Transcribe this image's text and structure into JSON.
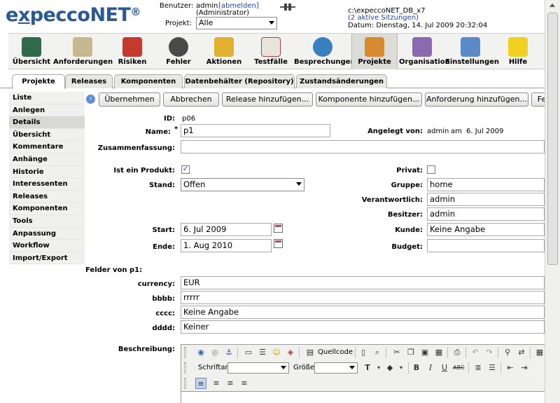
{
  "header": {
    "logo": {
      "part1": "e",
      "part2": "x",
      "part3": "pecco",
      "part4": "NET",
      "mark": "®"
    },
    "benutzer_label": "Benutzer:",
    "benutzer_name": "admin",
    "abmelden": "[abmelden]",
    "role": "(Administrator)",
    "projekt_label": "Projekt:",
    "projekt_value": "Alle",
    "db_path": "c:\\expeccoNET_DB_x7",
    "sessions": "(2 aktive Sitzungen)",
    "datum": "Datum: Dienstag, 14. Jul 2009 20:32:04"
  },
  "toolbar": [
    {
      "label": "Übersicht",
      "icon": "chart-icon"
    },
    {
      "label": "Anforderungen",
      "icon": "requirements-icon"
    },
    {
      "label": "Risiken",
      "icon": "risk-icon"
    },
    {
      "label": "Fehler",
      "icon": "bug-icon"
    },
    {
      "label": "Aktionen",
      "icon": "actions-icon"
    },
    {
      "label": "Testfälle",
      "icon": "testcases-icon"
    },
    {
      "label": "Besprechungen",
      "icon": "meetings-icon"
    },
    {
      "label": "Projekte",
      "icon": "projects-icon"
    },
    {
      "label": "Organisation",
      "icon": "organisation-icon"
    },
    {
      "label": "Einstellungen",
      "icon": "settings-icon"
    },
    {
      "label": "Hilfe",
      "icon": "help-icon"
    }
  ],
  "tabs": [
    "Projekte",
    "Releases",
    "Komponenten",
    "Datenbehälter (Repository)",
    "Zustandsänderungen"
  ],
  "sidebar": [
    "Liste",
    "Anlegen",
    "Details",
    "Übersicht",
    "Kommentare",
    "Anhänge",
    "Historie",
    "Interessenten",
    "Releases",
    "Komponenten",
    "Tools",
    "Anpassung",
    "Workflow",
    "Import/Export"
  ],
  "actions": [
    "Übernehmen",
    "Abbrechen",
    "Release hinzufügen...",
    "Komponente hinzufügen...",
    "Anforderung hinzufügen...",
    "Fe"
  ],
  "form": {
    "id_label": "ID:",
    "id_value": "p06",
    "name_label": "Name:",
    "name_required": "*",
    "name_value": "p1",
    "angelegt_label": "Angelegt von:",
    "angelegt_user": "admin",
    "angelegt_am": "am",
    "angelegt_date": "6. Jul 2009",
    "zusammenfassung_label": "Zusammenfassung:",
    "zusammenfassung_value": "",
    "produkt_label": "Ist ein Produkt:",
    "produkt_checked": true,
    "check_mark": "✓",
    "privat_label": "Privat:",
    "privat_checked": false,
    "stand_label": "Stand:",
    "stand_value": "Offen",
    "gruppe_label": "Gruppe:",
    "gruppe_value": "home",
    "verantwortlich_label": "Verantwortlich:",
    "verantwortlich_value": "admin",
    "besitzer_label": "Besitzer:",
    "besitzer_value": "admin",
    "start_label": "Start:",
    "start_value": "6. Jul 2009",
    "kunde_label": "Kunde:",
    "kunde_value": "Keine Angabe",
    "ende_label": "Ende:",
    "ende_value": "1. Aug 2010",
    "budget_label": "Budget:",
    "budget_value": "",
    "felder_label": "Felder von p1:",
    "currency_label": "currency:",
    "currency_value": "EUR",
    "bbbb_label": "bbbb:",
    "bbbb_value": "rrrrr",
    "cccc_label": "cccc:",
    "cccc_value": "Keine Angabe",
    "dddd_label": "dddd:",
    "dddd_value": "Keiner",
    "beschreibung_label": "Beschreibung:"
  },
  "editor": {
    "quellcode": "Quellcode",
    "schriftart": "Schriftart",
    "groesse": "Größe"
  }
}
